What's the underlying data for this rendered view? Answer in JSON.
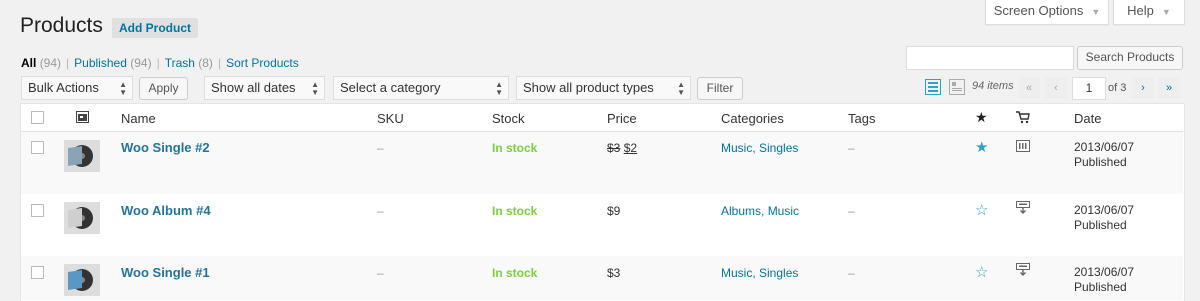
{
  "header": {
    "title": "Products",
    "add_button": "Add Product",
    "screen_options": "Screen Options",
    "help": "Help"
  },
  "views": {
    "all": "All",
    "all_count": "(94)",
    "published": "Published",
    "published_count": "(94)",
    "trash": "Trash",
    "trash_count": "(8)",
    "sort": "Sort Products",
    "separator": "|"
  },
  "search": {
    "value": "",
    "button": "Search Products"
  },
  "filters": {
    "bulk_actions": "Bulk Actions",
    "apply": "Apply",
    "dates": "Show all dates",
    "category": "Select a category",
    "product_types": "Show all product types",
    "filter": "Filter"
  },
  "pagination": {
    "items": "94 items",
    "first": "«",
    "prev": "‹",
    "current_page": "1",
    "of": "of 3",
    "next": "›",
    "last": "»"
  },
  "columns": {
    "name": "Name",
    "sku": "SKU",
    "stock": "Stock",
    "price": "Price",
    "categories": "Categories",
    "tags": "Tags",
    "date": "Date"
  },
  "rows": [
    {
      "name": "Woo Single #2",
      "sku": "–",
      "stock": "In stock",
      "price_old": "$3",
      "price": "$2",
      "cat1": "Music",
      "cat_sep": ", ",
      "cat2": "Singles",
      "tags": "–",
      "featured": true,
      "date": "2013/06/07",
      "status": "Published"
    },
    {
      "name": "Woo Album #4",
      "sku": "–",
      "stock": "In stock",
      "price_old": "",
      "price": "$9",
      "cat1": "Albums",
      "cat_sep": ", ",
      "cat2": "Music",
      "tags": "–",
      "featured": false,
      "date": "2013/06/07",
      "status": "Published"
    },
    {
      "name": "Woo Single #1",
      "sku": "–",
      "stock": "In stock",
      "price_old": "",
      "price": "$3",
      "cat1": "Music",
      "cat_sep": ", ",
      "cat2": "Singles",
      "tags": "–",
      "featured": false,
      "date": "2013/06/07",
      "status": "Published"
    }
  ],
  "icons": {
    "image_col": "image-icon",
    "featured_col": "star-icon",
    "type_col": "product-type-icon",
    "list_view": "list-view-icon",
    "excerpt_view": "excerpt-view-icon"
  },
  "colors": {
    "link": "#0074a2",
    "in_stock": "#7ad03a",
    "star": "#2ea2cc"
  }
}
